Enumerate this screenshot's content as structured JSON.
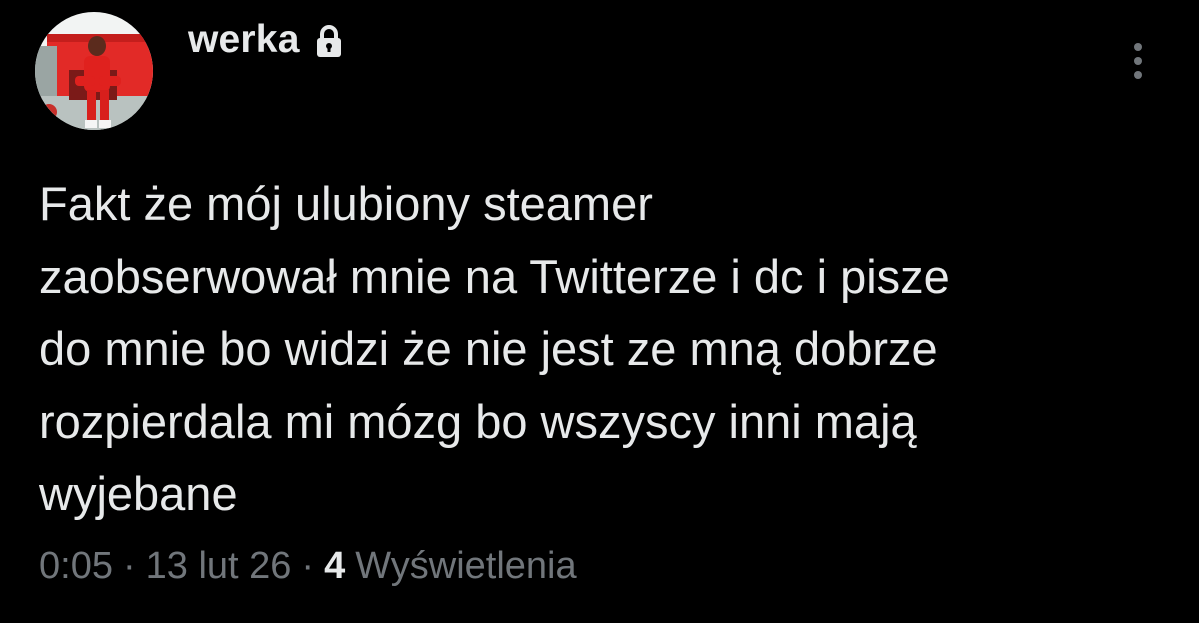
{
  "tweet": {
    "author": {
      "display_name": "werka",
      "protected_icon": "lock-icon",
      "avatar_icon": "avatar"
    },
    "more_icon": "more-vertical-icon",
    "text": "Fakt że mój ulubiony steamer\nzaobserwował mnie na Twitterze i dc i pisze\ndo mnie bo widzi że nie jest ze mną dobrze\nrozpierdala mi mózg bo wszyscy inni mają\nwyjebane",
    "meta": {
      "time": "0:05",
      "separator": "·",
      "date": "13 lut 26",
      "views_count": "4",
      "views_label": "Wyświetlenia"
    }
  },
  "colors": {
    "background": "#000000",
    "primary_text": "#e7e9ea",
    "secondary_text": "#71767b"
  }
}
